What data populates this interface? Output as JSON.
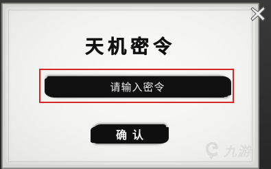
{
  "dialog": {
    "title": "天机密令",
    "password_field": {
      "placeholder": "请输入密令",
      "highlight_color": "#d32626"
    },
    "confirm_label": "确认",
    "close_icon": "close-x-icon"
  },
  "watermark": {
    "text": "九游",
    "logo_icon": "jiuyou-logo-icon"
  }
}
